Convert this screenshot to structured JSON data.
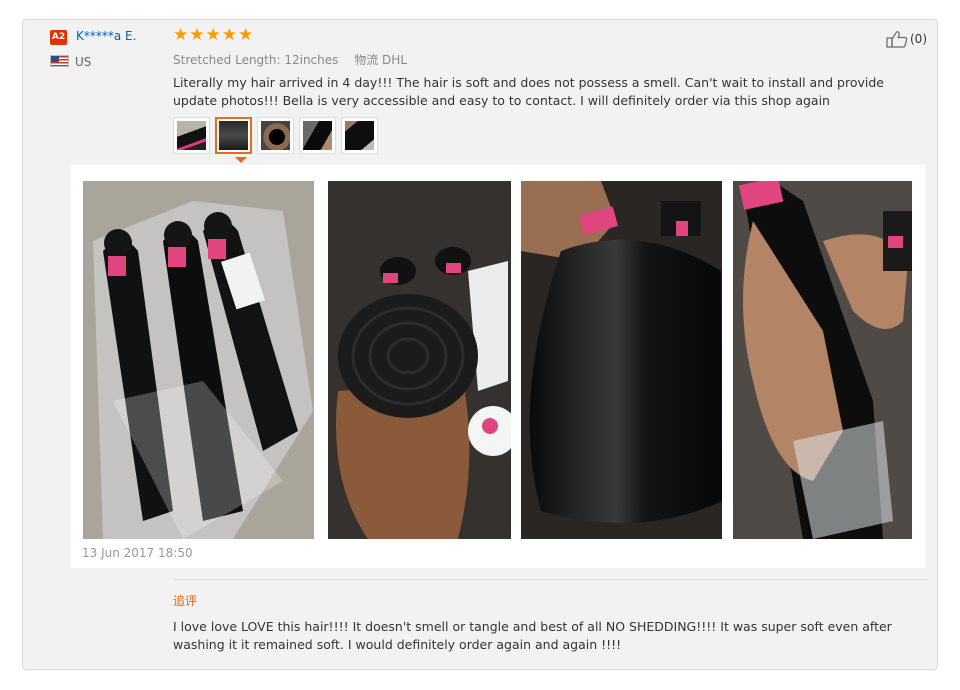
{
  "review": {
    "buyer": {
      "level_badge": "A2",
      "name": "K*****a E.",
      "country": "US",
      "flag_icon": "us-flag-icon"
    },
    "rating": {
      "stars": "★★★★★",
      "value": 5,
      "max": 5,
      "color": "#f59d01"
    },
    "attributes": {
      "length": "Stretched Length: 12inches",
      "shipping": "物流 DHL"
    },
    "text": "Literally my hair arrived in 4 day!!! The hair is soft and does not possess a smell. Can't wait to install and provide update photos!!! Bella is very accessible and easy to to contact. I will definitely order via this shop again",
    "helpful": {
      "icon": "thumbs-up-icon",
      "count": "(0)"
    },
    "thumbnails_count": 5,
    "active_thumbnail": 2,
    "date": "13 Jun 2017 18:50",
    "followup": {
      "label": "追评",
      "text": "I love love LOVE this hair!!!! It doesn't smell or tangle and best of all NO SHEDDING!!!! It was super soft even after washing it it remained soft. I would definitely order again and again !!!!"
    }
  },
  "colors": {
    "name_link": "#0061b0",
    "badge": "#e62e04",
    "accent": "#e66b1a",
    "followup_label": "#e6630a"
  }
}
